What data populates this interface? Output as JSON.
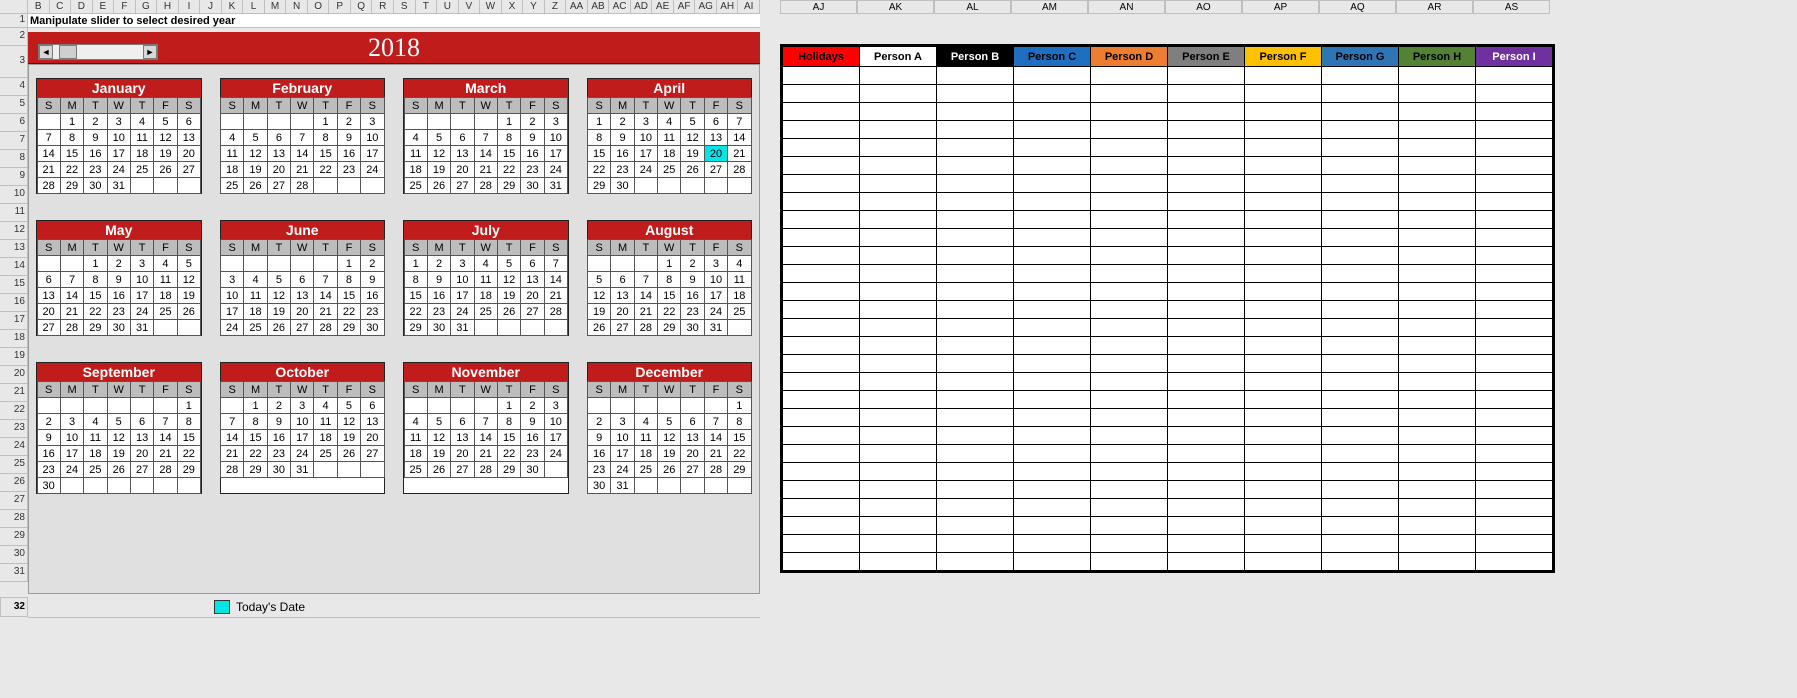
{
  "instruction": "Manipulate slider to select desired year",
  "year": "2018",
  "legend_label": "Today's Date",
  "today": {
    "month": 3,
    "day": 20
  },
  "col_letters_narrow": [
    "B",
    "C",
    "D",
    "E",
    "F",
    "G",
    "H",
    "I",
    "J",
    "K",
    "L",
    "M",
    "N",
    "O",
    "P",
    "Q",
    "R",
    "S",
    "T",
    "U",
    "V",
    "W",
    "X",
    "Y",
    "Z",
    "AA",
    "AB",
    "AC",
    "AD",
    "AE",
    "AF",
    "AG",
    "AH",
    "AI"
  ],
  "col_letters_wide": [
    "AJ",
    "AK",
    "AL",
    "AM",
    "AN",
    "AO",
    "AP",
    "AQ",
    "AR",
    "AS"
  ],
  "row_numbers": [
    1,
    2,
    3,
    4,
    5,
    6,
    7,
    8,
    9,
    10,
    11,
    12,
    13,
    14,
    15,
    16,
    17,
    18,
    19,
    20,
    21,
    22,
    23,
    24,
    25,
    26,
    27,
    28,
    29,
    30,
    31
  ],
  "dow": [
    "S",
    "M",
    "T",
    "W",
    "T",
    "F",
    "S"
  ],
  "months": [
    {
      "name": "January",
      "start": 1,
      "days": 31
    },
    {
      "name": "February",
      "start": 4,
      "days": 28
    },
    {
      "name": "March",
      "start": 4,
      "days": 31
    },
    {
      "name": "April",
      "start": 0,
      "days": 30
    },
    {
      "name": "May",
      "start": 2,
      "days": 31
    },
    {
      "name": "June",
      "start": 5,
      "days": 30
    },
    {
      "name": "July",
      "start": 0,
      "days": 31
    },
    {
      "name": "August",
      "start": 3,
      "days": 31
    },
    {
      "name": "September",
      "start": 6,
      "days": 30
    },
    {
      "name": "October",
      "start": 1,
      "days": 31
    },
    {
      "name": "November",
      "start": 4,
      "days": 30
    },
    {
      "name": "December",
      "start": 6,
      "days": 31
    }
  ],
  "people_headers": [
    {
      "label": "Holidays",
      "cls": "Holidays"
    },
    {
      "label": "Person A",
      "cls": "A"
    },
    {
      "label": "Person B",
      "cls": "B"
    },
    {
      "label": "Person C",
      "cls": "C"
    },
    {
      "label": "Person D",
      "cls": "D"
    },
    {
      "label": "Person E",
      "cls": "E"
    },
    {
      "label": "Person F",
      "cls": "F"
    },
    {
      "label": "Person G",
      "cls": "G"
    },
    {
      "label": "Person H",
      "cls": "H"
    },
    {
      "label": "Person I",
      "cls": "I"
    }
  ],
  "people_blank_rows": 28
}
